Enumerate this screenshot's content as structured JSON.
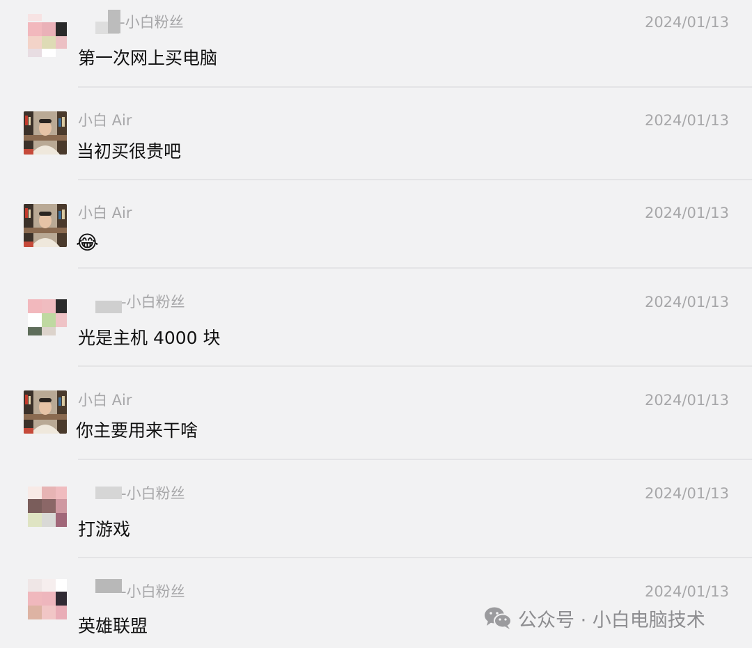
{
  "comments": [
    {
      "author": "-小白粉丝",
      "time": "2024/01/13",
      "text": "第一次网上买电脑"
    },
    {
      "author": "小白 Air",
      "time": "2024/01/13",
      "text": "当初买很贵吧"
    },
    {
      "author": "小白 Air",
      "time": "2024/01/13",
      "emoji": "😂"
    },
    {
      "author": "-小白粉丝",
      "time": "2024/01/13",
      "text": "光是主机 4000 块"
    },
    {
      "author": "小白 Air",
      "time": "2024/01/13",
      "text": "你主要用来干啥"
    },
    {
      "author": "-小白粉丝",
      "time": "2024/01/13",
      "text": "打游戏"
    },
    {
      "author": "-小白粉丝",
      "time": "2024/01/13",
      "text": "英雄联盟"
    }
  ],
  "watermark": {
    "text": "公众号 · 小白电脑技术",
    "icon": "wechat-icon"
  }
}
